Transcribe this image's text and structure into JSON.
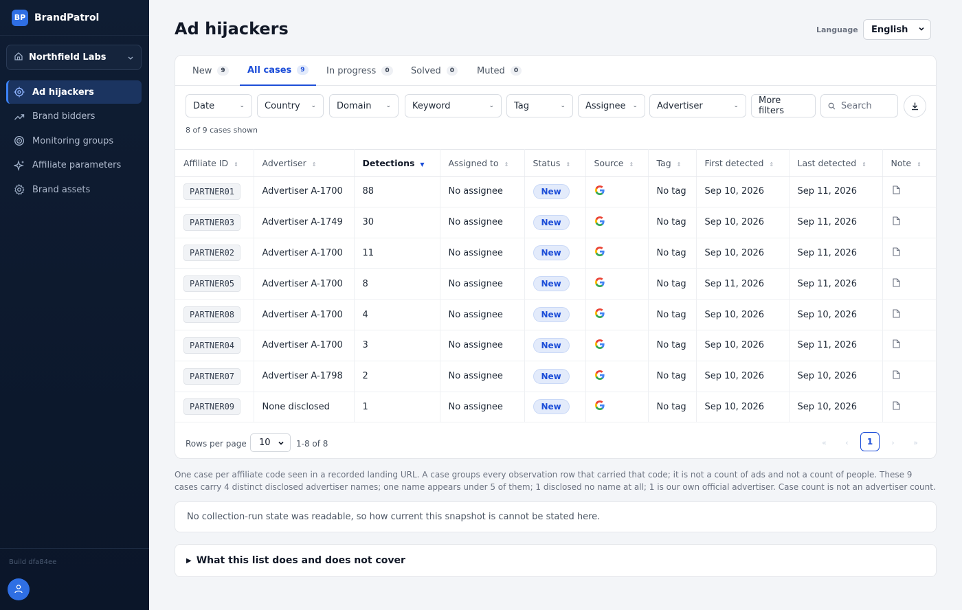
{
  "brand": {
    "logo": "BP",
    "name": "BrandPatrol"
  },
  "org": {
    "name": "Northfield Labs",
    "icon": "home-icon"
  },
  "nav": [
    {
      "label": "Ad hijackers",
      "icon": "target-icon",
      "active": true
    },
    {
      "label": "Brand bidders",
      "icon": "trending-icon",
      "active": false
    },
    {
      "label": "Monitoring groups",
      "icon": "circle-target-icon",
      "active": false
    },
    {
      "label": "Affiliate parameters",
      "icon": "sparkle-icon",
      "active": false
    },
    {
      "label": "Brand assets",
      "icon": "gear-icon",
      "active": false
    }
  ],
  "build": "Build dfa84ee",
  "page": {
    "title": "Ad hijackers",
    "language_label": "Language",
    "language_value": "English"
  },
  "tabs": [
    {
      "label": "New",
      "count": "9"
    },
    {
      "label": "All cases",
      "count": "9",
      "active": true
    },
    {
      "label": "In progress",
      "count": "0"
    },
    {
      "label": "Solved",
      "count": "0"
    },
    {
      "label": "Muted",
      "count": "0"
    }
  ],
  "filters": {
    "date": "Date",
    "country": "Country",
    "domain": "Domain",
    "keyword": "Keyword",
    "tag": "Tag",
    "assignee": "Assignee",
    "advertiser": "Advertiser",
    "more": "More filters",
    "search_placeholder": "Search"
  },
  "shown_text": "8 of 9 cases shown",
  "columns": [
    "Affiliate ID",
    "Advertiser",
    "Detections",
    "Assigned to",
    "Status",
    "Source",
    "Tag",
    "First detected",
    "Last detected",
    "Note"
  ],
  "rows": [
    {
      "affiliate": "PARTNER01",
      "advertiser": "Advertiser A-1700",
      "detections": "88",
      "assigned": "No assignee",
      "status": "New",
      "tag": "No tag",
      "first": "Sep 10, 2026",
      "last": "Sep 11, 2026"
    },
    {
      "affiliate": "PARTNER03",
      "advertiser": "Advertiser A-1749",
      "detections": "30",
      "assigned": "No assignee",
      "status": "New",
      "tag": "No tag",
      "first": "Sep 10, 2026",
      "last": "Sep 11, 2026"
    },
    {
      "affiliate": "PARTNER02",
      "advertiser": "Advertiser A-1700",
      "detections": "11",
      "assigned": "No assignee",
      "status": "New",
      "tag": "No tag",
      "first": "Sep 10, 2026",
      "last": "Sep 11, 2026"
    },
    {
      "affiliate": "PARTNER05",
      "advertiser": "Advertiser A-1700",
      "detections": "8",
      "assigned": "No assignee",
      "status": "New",
      "tag": "No tag",
      "first": "Sep 11, 2026",
      "last": "Sep 11, 2026"
    },
    {
      "affiliate": "PARTNER08",
      "advertiser": "Advertiser A-1700",
      "detections": "4",
      "assigned": "No assignee",
      "status": "New",
      "tag": "No tag",
      "first": "Sep 10, 2026",
      "last": "Sep 10, 2026"
    },
    {
      "affiliate": "PARTNER04",
      "advertiser": "Advertiser A-1700",
      "detections": "3",
      "assigned": "No assignee",
      "status": "New",
      "tag": "No tag",
      "first": "Sep 10, 2026",
      "last": "Sep 11, 2026"
    },
    {
      "affiliate": "PARTNER07",
      "advertiser": "Advertiser A-1798",
      "detections": "2",
      "assigned": "No assignee",
      "status": "New",
      "tag": "No tag",
      "first": "Sep 10, 2026",
      "last": "Sep 10, 2026"
    },
    {
      "affiliate": "PARTNER09",
      "advertiser": "None disclosed",
      "detections": "1",
      "assigned": "No assignee",
      "status": "New",
      "tag": "No tag",
      "first": "Sep 10, 2026",
      "last": "Sep 10, 2026"
    }
  ],
  "pager": {
    "rows_label": "Rows per page",
    "rows_value": "10",
    "range": "1-8 of 8",
    "current_page": "1"
  },
  "explain": "One case per affiliate code seen in a recorded landing URL. A case groups every observation row that carried that code; it is not a count of ads and not a count of people. These 9 cases carry 4 distinct disclosed advertiser names; one name appears under 5 of them; 1 disclosed no name at all; 1 is our own official advertiser. Case count is not an advertiser count.",
  "notice": "No collection-run state was readable, so how current this snapshot is cannot be stated here.",
  "details_summary": "What this list does and does not cover",
  "colors": {
    "accent": "#1d4ed8",
    "sidebar": "#0f1d33",
    "badge_bg": "#e3ebfb"
  }
}
